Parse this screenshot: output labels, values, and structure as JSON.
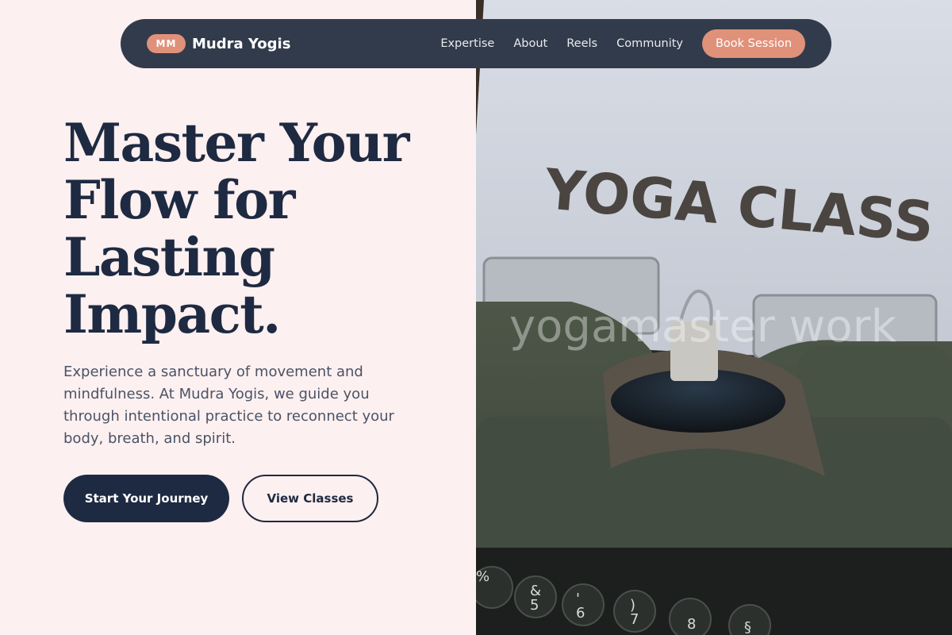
{
  "brand": {
    "badge": "MM",
    "name": "Mudra Yogis"
  },
  "nav": {
    "links": [
      "Expertise",
      "About",
      "Reels",
      "Community"
    ],
    "cta": "Book Session"
  },
  "hero": {
    "title_lines": [
      "Master Your",
      "Flow for",
      "Lasting",
      "Impact."
    ],
    "description": "Experience a sanctuary of movement and mindfulness. At Mudra Yogis, we guide you through intentional practice to reconnect your body, breath, and spirit.",
    "primary_button": "Start Your Journey",
    "secondary_button": "View Classes"
  },
  "image": {
    "paper_text": "YOGA CLASS",
    "watermark": "yogamaster work",
    "keys": [
      "%",
      "&\n5",
      "'\n6",
      ")\n7",
      "8",
      "§"
    ]
  },
  "colors": {
    "background": "#fdf0f0",
    "navy": "#1e2a42",
    "nav_bg": "#323b4b",
    "accent": "#e0917a"
  }
}
